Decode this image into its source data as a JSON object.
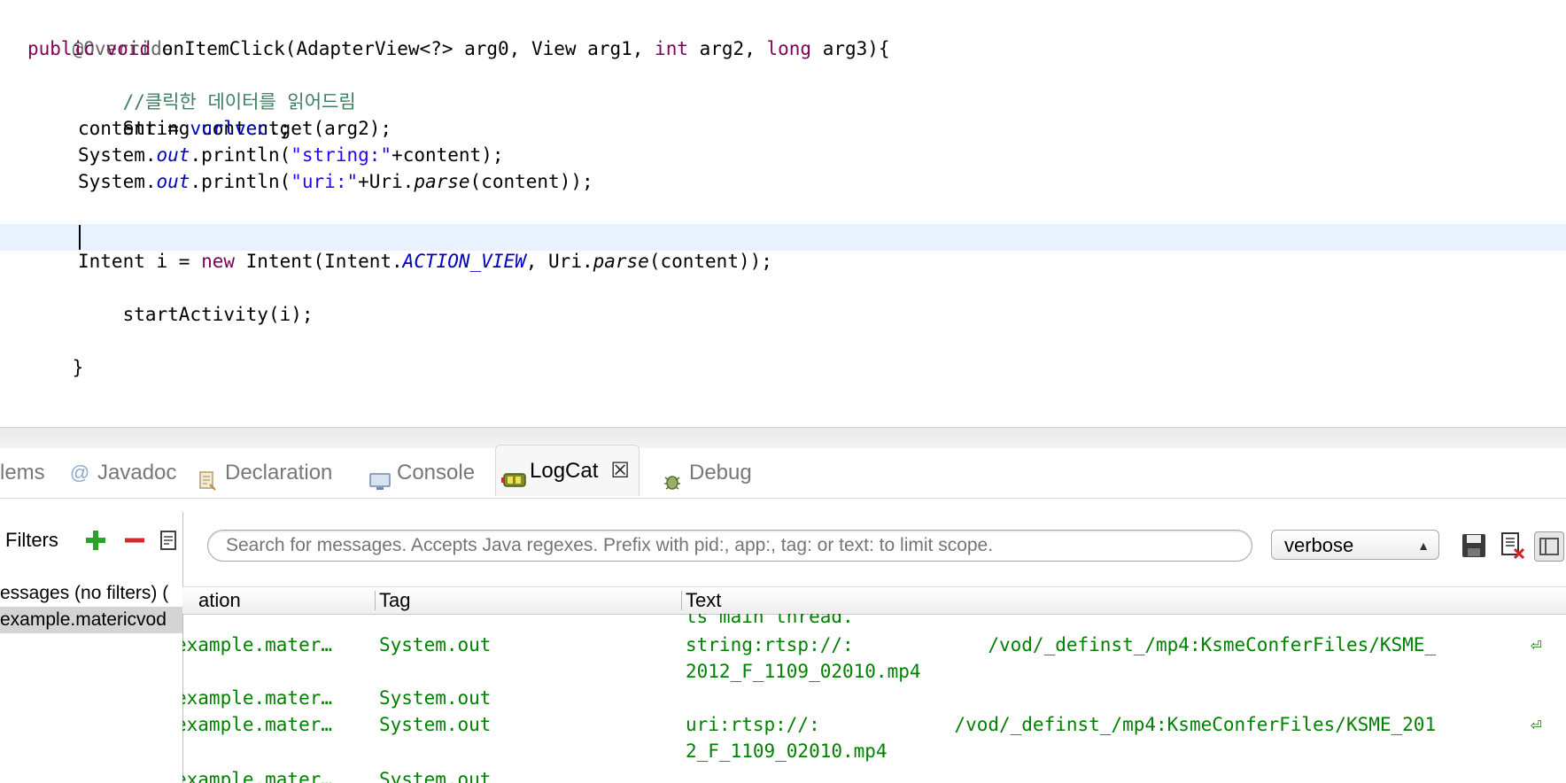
{
  "editor": {
    "lines": {
      "l1": "@Override",
      "l2_kw1": "public",
      "l2_kw2": "void",
      "l2_a": " onItemClick(AdapterView<?> arg0, View arg1, ",
      "l2_kw3": "int",
      "l2_b": " arg2, ",
      "l2_kw4": "long",
      "l2_c": " arg3){",
      "l3": "//클릭한 데이터를 읽어드림",
      "l4": "String content;",
      "l5_a": "content = ",
      "l5_f": "vurlvec",
      "l5_b": ".get(arg2);",
      "l6_a": "System.",
      "l6_f": "out",
      "l6_b": ".println(",
      "l6_s": "\"string:\"",
      "l6_c": "+content);",
      "l7_a": "System.",
      "l7_f": "out",
      "l7_b": ".println(",
      "l7_s": "\"uri:\"",
      "l7_c": "+Uri.",
      "l7_m": "parse",
      "l7_d": "(content));",
      "l9_a": "Intent i = ",
      "l9_kw": "new",
      "l9_b": " Intent(Intent.",
      "l9_f": "ACTION_VIEW",
      "l9_c": ", Uri.",
      "l9_m": "parse",
      "l9_d": "(content));",
      "l10": "startActivity(i);",
      "l12": "}"
    }
  },
  "tabs": {
    "problems": "lems",
    "javadoc": "Javadoc",
    "declaration": "Declaration",
    "console": "Console",
    "logcat": "LogCat",
    "debug": "Debug"
  },
  "filters": {
    "title": "Filters",
    "items": [
      "essages (no filters) (",
      "example.matericvod"
    ]
  },
  "logcat": {
    "search_placeholder": "Search for messages. Accepts Java regexes. Prefix with pid:, app:, tag: or text: to limit scope.",
    "level": "verbose",
    "columns": {
      "application": "ation",
      "tag": "Tag",
      "text": "Text"
    },
    "rows": [
      {
        "app": "",
        "tag": "",
        "text": "ts main thread."
      },
      {
        "app": "example.mater…",
        "tag": "System.out",
        "text": "string:rtsp://:            /vod/_definst_/mp4:KsmeConferFiles/KSME_",
        "text2": "2012_F_1109_02010.mp4"
      },
      {
        "app": "example.mater…",
        "tag": "System.out",
        "text": ""
      },
      {
        "app": "example.mater…",
        "tag": "System.out",
        "text": "uri:rtsp://:            /vod/_definst_/mp4:KsmeConferFiles/KSME_201",
        "text2": "2_F_1109_02010.mp4"
      },
      {
        "app": "example.mater…",
        "tag": "System.out",
        "text": ""
      }
    ],
    "wrap_symbol": "⏎"
  }
}
